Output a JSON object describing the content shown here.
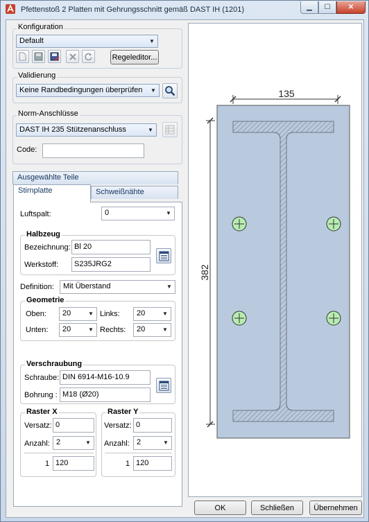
{
  "window": {
    "title": "Pfettenstoß 2 Platten mit Gehrungsschnitt gemäß DAST IH (1201)",
    "min_symbol": "▁",
    "max_symbol": "☐",
    "close_symbol": "✕"
  },
  "konfiguration": {
    "legend": "Konfiguration",
    "selected": "Default",
    "regeleditor_label": "Regeleditor..."
  },
  "validierung": {
    "legend": "Validierung",
    "selected": "Keine Randbedingungen überprüfen"
  },
  "norm": {
    "legend": "Norm-Anschlüsse",
    "selected": "DAST IH 235 Stützenanschluss",
    "code_label": "Code:",
    "code_value": ""
  },
  "tabs": {
    "outer_label": "Ausgewählte Teile",
    "stirnplatte": "Stirnplatte",
    "schweissnaehte": "Schweißnähte"
  },
  "stirnplatte": {
    "luftspalt_label": "Luftspalt:",
    "luftspalt_value": "0",
    "halbzeug_legend": "Halbzeug",
    "bezeichnung_label": "Bezeichnung:",
    "bezeichnung_value": "Bl 20",
    "werkstoff_label": "Werkstoff:",
    "werkstoff_value": "S235JRG2",
    "definition_label": "Definition:",
    "definition_value": "Mit Überstand",
    "geometrie_legend": "Geometrie",
    "oben_label": "Oben:",
    "oben_value": "20",
    "links_label": "Links:",
    "links_value": "20",
    "unten_label": "Unten:",
    "unten_value": "20",
    "rechts_label": "Rechts:",
    "rechts_value": "20",
    "verschraubung_legend": "Verschraubung",
    "schraube_label": "Schraube:",
    "schraube_value": "DIN 6914-M16-10.9",
    "bohrung_label": "Bohrung :",
    "bohrung_value": "M18 (Ø20)",
    "raster_x": {
      "legend": "Raster X",
      "versatz_label": "Versatz:",
      "versatz_value": "0",
      "anzahl_label": "Anzahl:",
      "anzahl_value": "2",
      "row_index": "1",
      "row_value": "120"
    },
    "raster_y": {
      "legend": "Raster Y",
      "versatz_label": "Versatz:",
      "versatz_value": "0",
      "anzahl_label": "Anzahl:",
      "anzahl_value": "2",
      "row_index": "1",
      "row_value": "120"
    }
  },
  "preview": {
    "width_dim": "135",
    "height_dim": "382"
  },
  "buttons": {
    "ok": "OK",
    "schliessen": "Schließen",
    "uebernehmen": "Übernehmen"
  },
  "colors": {
    "plate_fill": "#b9cade",
    "hatch": "#7f8794",
    "bolt_fill": "#b7ecb1",
    "accent": "#c7412b"
  }
}
